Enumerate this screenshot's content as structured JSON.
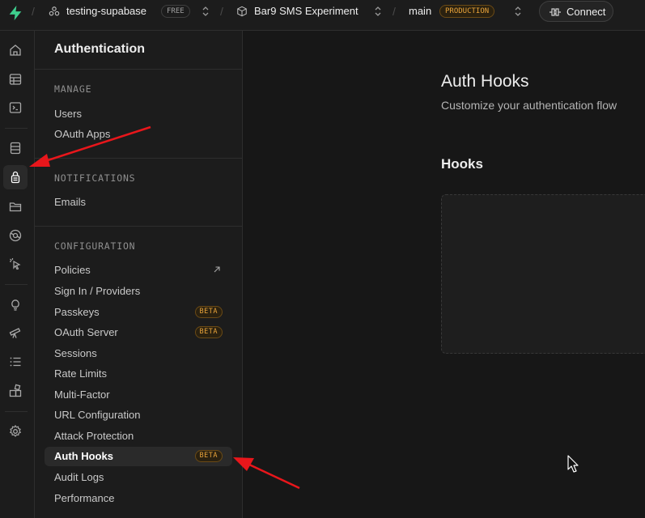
{
  "topbar": {
    "org_name": "testing-supabase",
    "org_plan": "FREE",
    "project_name": "Bar9 SMS Experiment",
    "branch_name": "main",
    "branch_env": "PRODUCTION",
    "connect_label": "Connect"
  },
  "rail": {
    "items": [
      "home-icon",
      "table-editor-icon",
      "sql-editor-icon",
      "database-icon",
      "auth-icon",
      "storage-icon",
      "edge-functions-icon",
      "realtime-icon",
      "advisors-icon",
      "observability-icon",
      "logs-icon",
      "integrations-icon",
      "settings-icon"
    ],
    "active": "auth-icon"
  },
  "sidebar": {
    "title": "Authentication",
    "manage": {
      "heading": "MANAGE",
      "items": [
        {
          "label": "Users"
        },
        {
          "label": "OAuth Apps"
        }
      ]
    },
    "notifications": {
      "heading": "NOTIFICATIONS",
      "items": [
        {
          "label": "Emails"
        }
      ]
    },
    "configuration": {
      "heading": "CONFIGURATION",
      "items": [
        {
          "label": "Policies"
        },
        {
          "label": "Sign In / Providers"
        },
        {
          "label": "Passkeys",
          "badge": "BETA"
        },
        {
          "label": "OAuth Server",
          "badge": "BETA"
        },
        {
          "label": "Sessions"
        },
        {
          "label": "Rate Limits"
        },
        {
          "label": "Multi-Factor"
        },
        {
          "label": "URL Configuration"
        },
        {
          "label": "Attack Protection"
        },
        {
          "label": "Auth Hooks",
          "badge": "BETA"
        },
        {
          "label": "Audit Logs"
        },
        {
          "label": "Performance"
        }
      ]
    }
  },
  "main": {
    "title": "Auth Hooks",
    "subtitle": "Customize your authentication flow",
    "hooks_heading": "Hooks"
  },
  "colors": {
    "accent_green": "#3ecf8e",
    "beta_orange": "#e8a33a",
    "annotation_red": "#e8161b"
  }
}
